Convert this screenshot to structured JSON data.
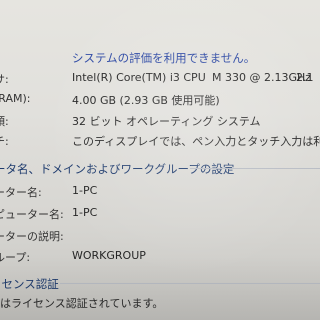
{
  "rating_link": "システムの評価を利用できません。",
  "system": {
    "processor_label": "サ:",
    "processor_value": "Intel(R) Core(TM) i3 CPU",
    "processor_model": "M 330  @ 2.13GHz",
    "processor_speed": "2.1",
    "ram_label": "(RAM):",
    "ram_value": "4.00 GB (2.93 GB 使用可能)",
    "type_label": "類:",
    "type_value": "32 ビット オペレーティング システム",
    "touch_label": "チ:",
    "touch_value": "このディスプレイでは、ペン入力とタッチ入力は利用でき"
  },
  "computer_section": {
    "header": "ータ名、ドメインおよびワークグループの設定",
    "name_label": "ーター名:",
    "name_value": "1-PC",
    "full_name_label": "ピューター名:",
    "full_name_value": "1-PC",
    "description_label": "ーターの説明:",
    "description_value": "",
    "workgroup_label": "ループ:",
    "workgroup_value": "WORKGROUP"
  },
  "activation_section": {
    "header": "イセンス認証",
    "status": "はライセンス認証されています。",
    "cut_text": "..."
  }
}
